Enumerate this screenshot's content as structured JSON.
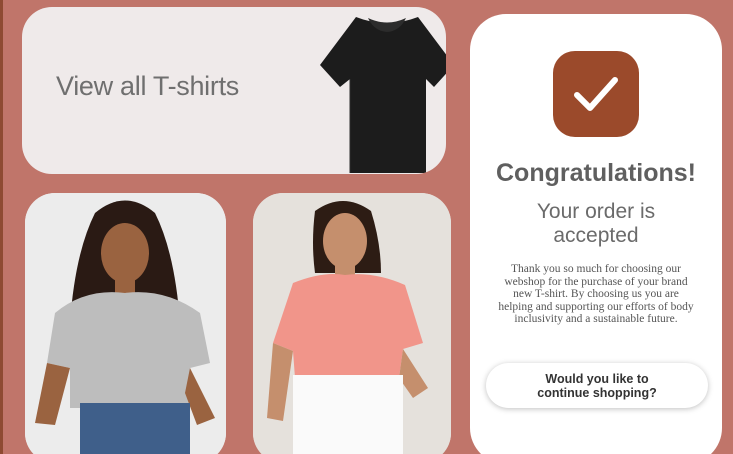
{
  "banner": {
    "label": "View all T-shirts"
  },
  "confirmation": {
    "title": "Congratulations!",
    "subtitle": "Your order is accepted",
    "message": "Thank you so much for choosing our webshop for the purchase of your brand new T-shirt. By choosing us you are helping and supporting our efforts of body inclusivity and a sustainable future.",
    "cta_label": "Would you like to continue shopping?"
  },
  "icons": {
    "confirm": "checkmark-icon",
    "product": "black-tshirt-image"
  },
  "colors": {
    "background": "#c0756a",
    "accent": "#9b4a2b",
    "card": "#ffffff",
    "banner": "#efeaea"
  }
}
